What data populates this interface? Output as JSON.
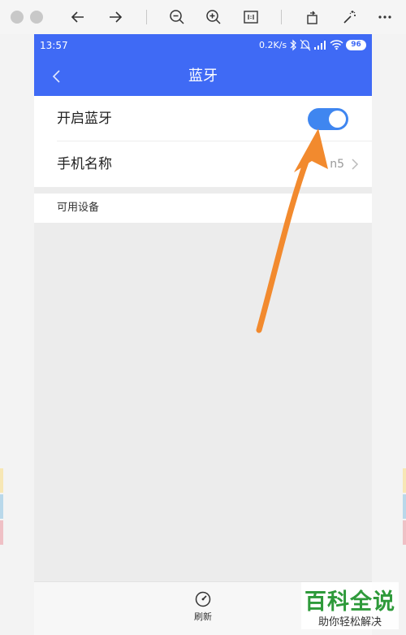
{
  "status_bar": {
    "time": "13:57",
    "network_speed": "0.2K/s",
    "battery": "96",
    "icons": [
      "bluetooth-icon",
      "mute-icon",
      "signal-icon",
      "wifi-icon",
      "battery-icon"
    ]
  },
  "header": {
    "title": "蓝牙"
  },
  "settings": {
    "bluetooth_toggle_label": "开启蓝牙",
    "bluetooth_enabled": true,
    "phone_name_label": "手机名称",
    "phone_name_value": "n5"
  },
  "section": {
    "available_devices": "可用设备"
  },
  "bottom": {
    "refresh_label": "刷新"
  },
  "watermark": {
    "main": "百科全说",
    "sub": "助你轻松解决"
  },
  "colors": {
    "accent": "#3f6af5",
    "toggle_on": "#3f86f0",
    "annotation_arrow": "#f28a2e",
    "watermark_green": "#2e9a3a"
  }
}
